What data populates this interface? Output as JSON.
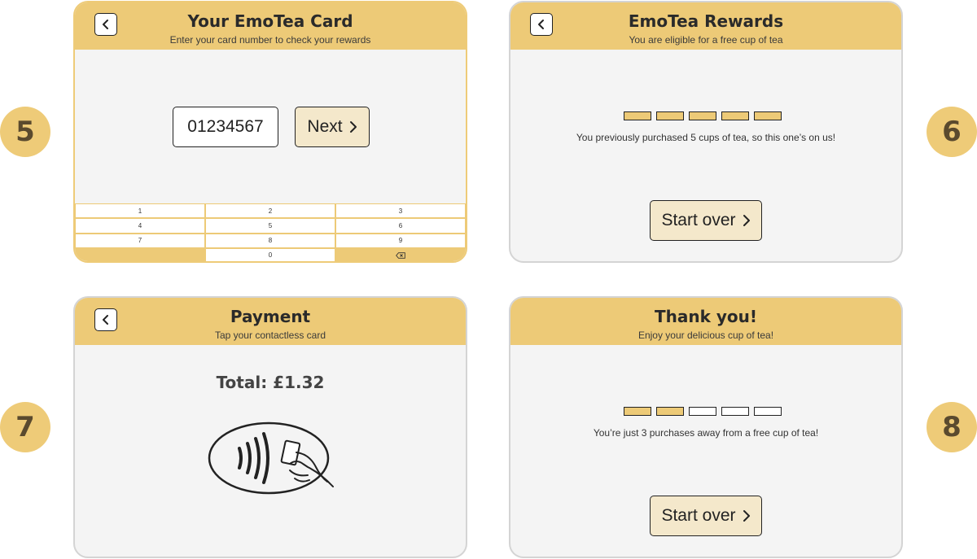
{
  "steps": [
    "5",
    "6",
    "7",
    "8"
  ],
  "screen5": {
    "title": "Your EmoTea Card",
    "subtitle": "Enter your card number to check your rewards",
    "card_number": "01234567",
    "next_label": "Next",
    "keys": [
      "1",
      "2",
      "3",
      "4",
      "5",
      "6",
      "7",
      "8",
      "9",
      "0"
    ]
  },
  "screen6": {
    "title": "EmoTea Rewards",
    "subtitle": "You are eligible for a free cup of tea",
    "stamps_filled": 5,
    "stamps_total": 5,
    "message": "You previously purchased 5 cups of tea, so this one’s on us!",
    "start_over_label": "Start over"
  },
  "screen7": {
    "title": "Payment",
    "subtitle": "Tap your contactless card",
    "total": "Total: £1.32"
  },
  "screen8": {
    "title": "Thank you!",
    "subtitle": "Enjoy your delicious cup of tea!",
    "stamps_filled": 2,
    "stamps_total": 5,
    "message": "You’re just 3 purchases away from a free cup of tea!",
    "start_over_label": "Start over"
  },
  "colors": {
    "accent": "#edca77",
    "button_bg": "#f4e8cb",
    "card_bg": "#f4f4f4"
  },
  "icons": [
    "back-arrow-icon",
    "chevron-right-icon",
    "backspace-icon",
    "contactless-payment-icon"
  ]
}
